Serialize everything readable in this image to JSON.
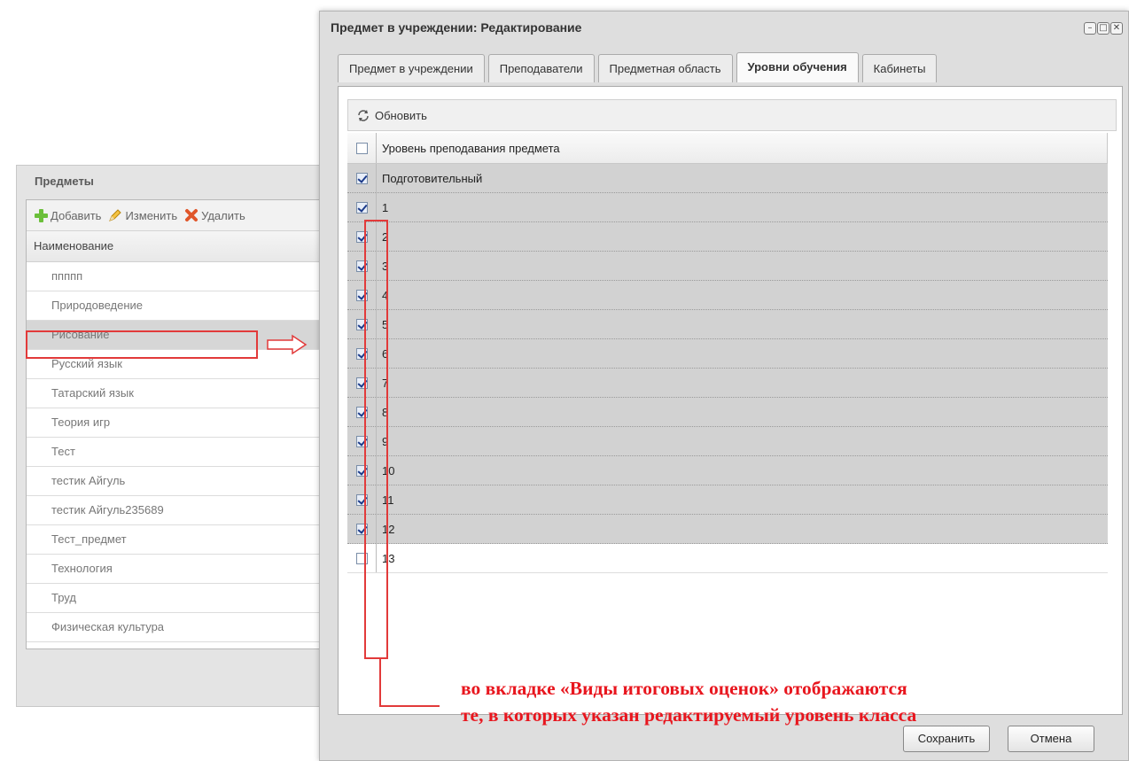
{
  "left_panel": {
    "title": "Предметы",
    "toolbar": {
      "add": "Добавить",
      "edit": "Изменить",
      "delete": "Удалить"
    },
    "column_header": "Наименование",
    "rows": [
      "ппппп",
      "Природоведение",
      "Рисование",
      "Русский язык",
      "Татарский язык",
      "Теория игр",
      "Тест",
      "тестик Айгуль",
      "тестик Айгуль235689",
      "Тест_предмет",
      "Технология",
      "Труд",
      "Физическая культура"
    ],
    "selected_index": 2
  },
  "dialog": {
    "title": "Предмет в учреждении: Редактирование",
    "tabs": [
      "Предмет в учреждении",
      "Преподаватели",
      "Предметная область",
      "Уровни обучения",
      "Кабинеты"
    ],
    "active_tab": "Уровни обучения",
    "refresh_label": "Обновить",
    "grid_header": "Уровень преподавания предмета",
    "levels": [
      {
        "label": "Подготовительный",
        "checked": true
      },
      {
        "label": "1",
        "checked": true
      },
      {
        "label": "2",
        "checked": true
      },
      {
        "label": "3",
        "checked": true
      },
      {
        "label": "4",
        "checked": true
      },
      {
        "label": "5",
        "checked": true
      },
      {
        "label": "6",
        "checked": true
      },
      {
        "label": "7",
        "checked": true
      },
      {
        "label": "8",
        "checked": true
      },
      {
        "label": "9",
        "checked": true
      },
      {
        "label": "10",
        "checked": true
      },
      {
        "label": "11",
        "checked": true
      },
      {
        "label": "12",
        "checked": true
      },
      {
        "label": "13",
        "checked": false
      }
    ],
    "note_line1": "во вкладке «Виды итоговых оценок» отображаются",
    "note_line2": "те, в которых указан редактируемый уровень класса",
    "save_label": "Сохранить",
    "cancel_label": "Отмена"
  },
  "colors": {
    "annotation_red": "#e23a3a",
    "note_red": "#e8161e",
    "selected_row": "#d2d2d2"
  }
}
